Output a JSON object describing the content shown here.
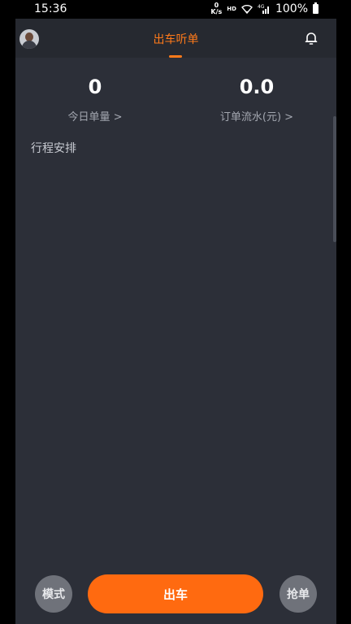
{
  "status_bar": {
    "time": "15:36",
    "net_speed_value": "0",
    "net_speed_unit": "K/s",
    "hd": "HD",
    "battery": "100%"
  },
  "header": {
    "title": "出车听单"
  },
  "stats": {
    "orders_today": {
      "value": "0",
      "label": "今日单量 >"
    },
    "order_revenue": {
      "value": "0.0",
      "label": "订单流水(元) >"
    }
  },
  "schedule": {
    "title": "行程安排"
  },
  "bottom": {
    "mode_label": "模式",
    "depart_label": "出车",
    "grab_label": "抢单"
  },
  "colors": {
    "accent": "#ff7a1a",
    "background": "#2c2f38"
  }
}
